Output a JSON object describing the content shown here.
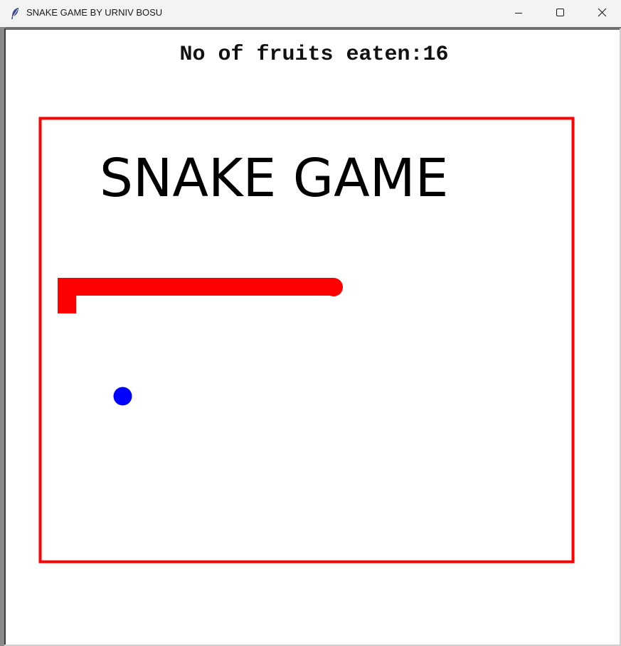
{
  "window": {
    "title": "SNAKE GAME BY URNIV BOSU",
    "icon": "feather-icon"
  },
  "controls": {
    "minimize_icon": "minimize-icon",
    "maximize_icon": "maximize-icon",
    "close_icon": "close-icon"
  },
  "hud": {
    "score_text": "No of fruits eaten:16"
  },
  "board": {
    "title": "SNAKE GAME",
    "border_color": "#ff0000",
    "snake_color": "#ff0000",
    "fruit_color": "#0000ff"
  }
}
